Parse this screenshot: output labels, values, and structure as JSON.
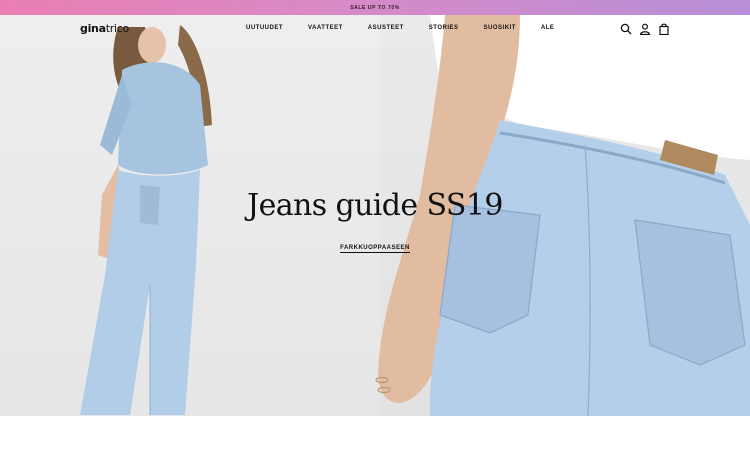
{
  "promo": {
    "text": "SALE UP TO 70%"
  },
  "header": {
    "logo_bold": "gina",
    "logo_rest": "trico",
    "nav": [
      {
        "label": "UUTUUDET"
      },
      {
        "label": "VAATTEET"
      },
      {
        "label": "ASUSTEET"
      },
      {
        "label": "STORIES"
      },
      {
        "label": "SUOSIKIT"
      },
      {
        "label": "ALE"
      }
    ],
    "icons": [
      "search-icon",
      "account-icon",
      "bag-icon"
    ]
  },
  "hero": {
    "title": "Jeans guide SS19",
    "cta": "FARKKUOPPAASEEN"
  },
  "colors": {
    "promo_start": "#ea7fb4",
    "promo_end": "#b78fd8",
    "denim": "#a9c7e4",
    "text": "#111111"
  }
}
